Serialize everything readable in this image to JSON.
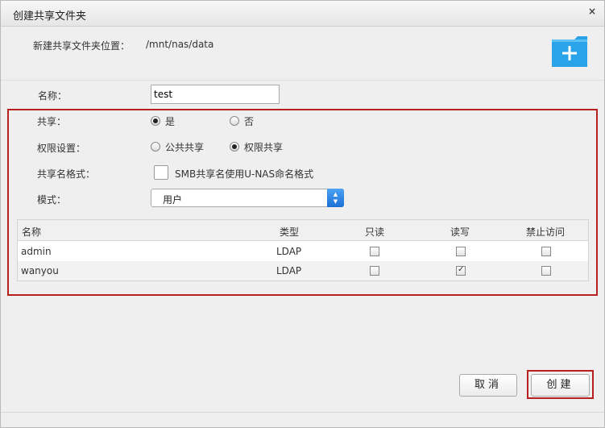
{
  "dialog": {
    "title": "创建共享文件夹",
    "close_glyph": "×"
  },
  "location": {
    "label": "新建共享文件夹位置：",
    "value": "/mnt/nas/data"
  },
  "form": {
    "name_label": "名称：",
    "name_value": "test",
    "share_label": "共享：",
    "share_options": [
      "是",
      "否"
    ],
    "share_selected": "是",
    "perm_label": "权限设置：",
    "perm_options": [
      "公共共享",
      "权限共享"
    ],
    "perm_selected": "权限共享",
    "format_label": "共享名格式：",
    "format_checkbox_label": "SMB共享名使用U-NAS命名格式",
    "format_checked": false,
    "mode_label": "模式：",
    "mode_value": "用户"
  },
  "table": {
    "headers": [
      "名称",
      "类型",
      "只读",
      "读写",
      "禁止访问"
    ],
    "rows": [
      {
        "name": "admin",
        "type": "LDAP",
        "readonly": false,
        "readwrite": false,
        "deny": false
      },
      {
        "name": "wanyou",
        "type": "LDAP",
        "readonly": false,
        "readwrite": true,
        "deny": false
      }
    ]
  },
  "buttons": {
    "cancel": "取消",
    "create": "创建"
  },
  "icons": {
    "folder_add": "folder-add-icon",
    "accent": "#2aa3e8"
  }
}
